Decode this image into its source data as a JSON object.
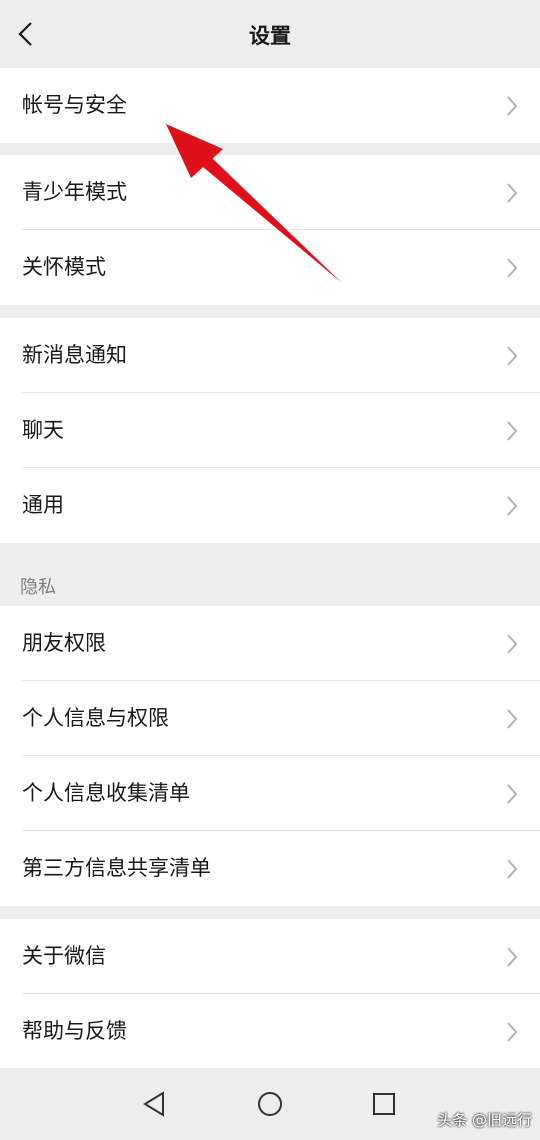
{
  "header": {
    "title": "设置"
  },
  "groups": [
    {
      "items": [
        {
          "label": "帐号与安全"
        }
      ]
    },
    {
      "items": [
        {
          "label": "青少年模式"
        },
        {
          "label": "关怀模式"
        }
      ]
    },
    {
      "items": [
        {
          "label": "新消息通知"
        },
        {
          "label": "聊天"
        },
        {
          "label": "通用"
        }
      ]
    },
    {
      "section_label": "隐私",
      "items": [
        {
          "label": "朋友权限"
        },
        {
          "label": "个人信息与权限"
        },
        {
          "label": "个人信息收集清单"
        },
        {
          "label": "第三方信息共享清单"
        }
      ]
    },
    {
      "items": [
        {
          "label": "关于微信"
        },
        {
          "label": "帮助与反馈"
        }
      ]
    }
  ],
  "watermark": "头条 @旧远行",
  "colors": {
    "annotation_arrow": "#e0101a",
    "background": "#ededed",
    "chevron": "#b2b2b2"
  },
  "icons": {
    "back": "chevron-left-icon",
    "row_chevron": "chevron-right-icon",
    "nav_back": "triangle-back-icon",
    "nav_home": "circle-home-icon",
    "nav_recent": "square-recent-icon"
  }
}
